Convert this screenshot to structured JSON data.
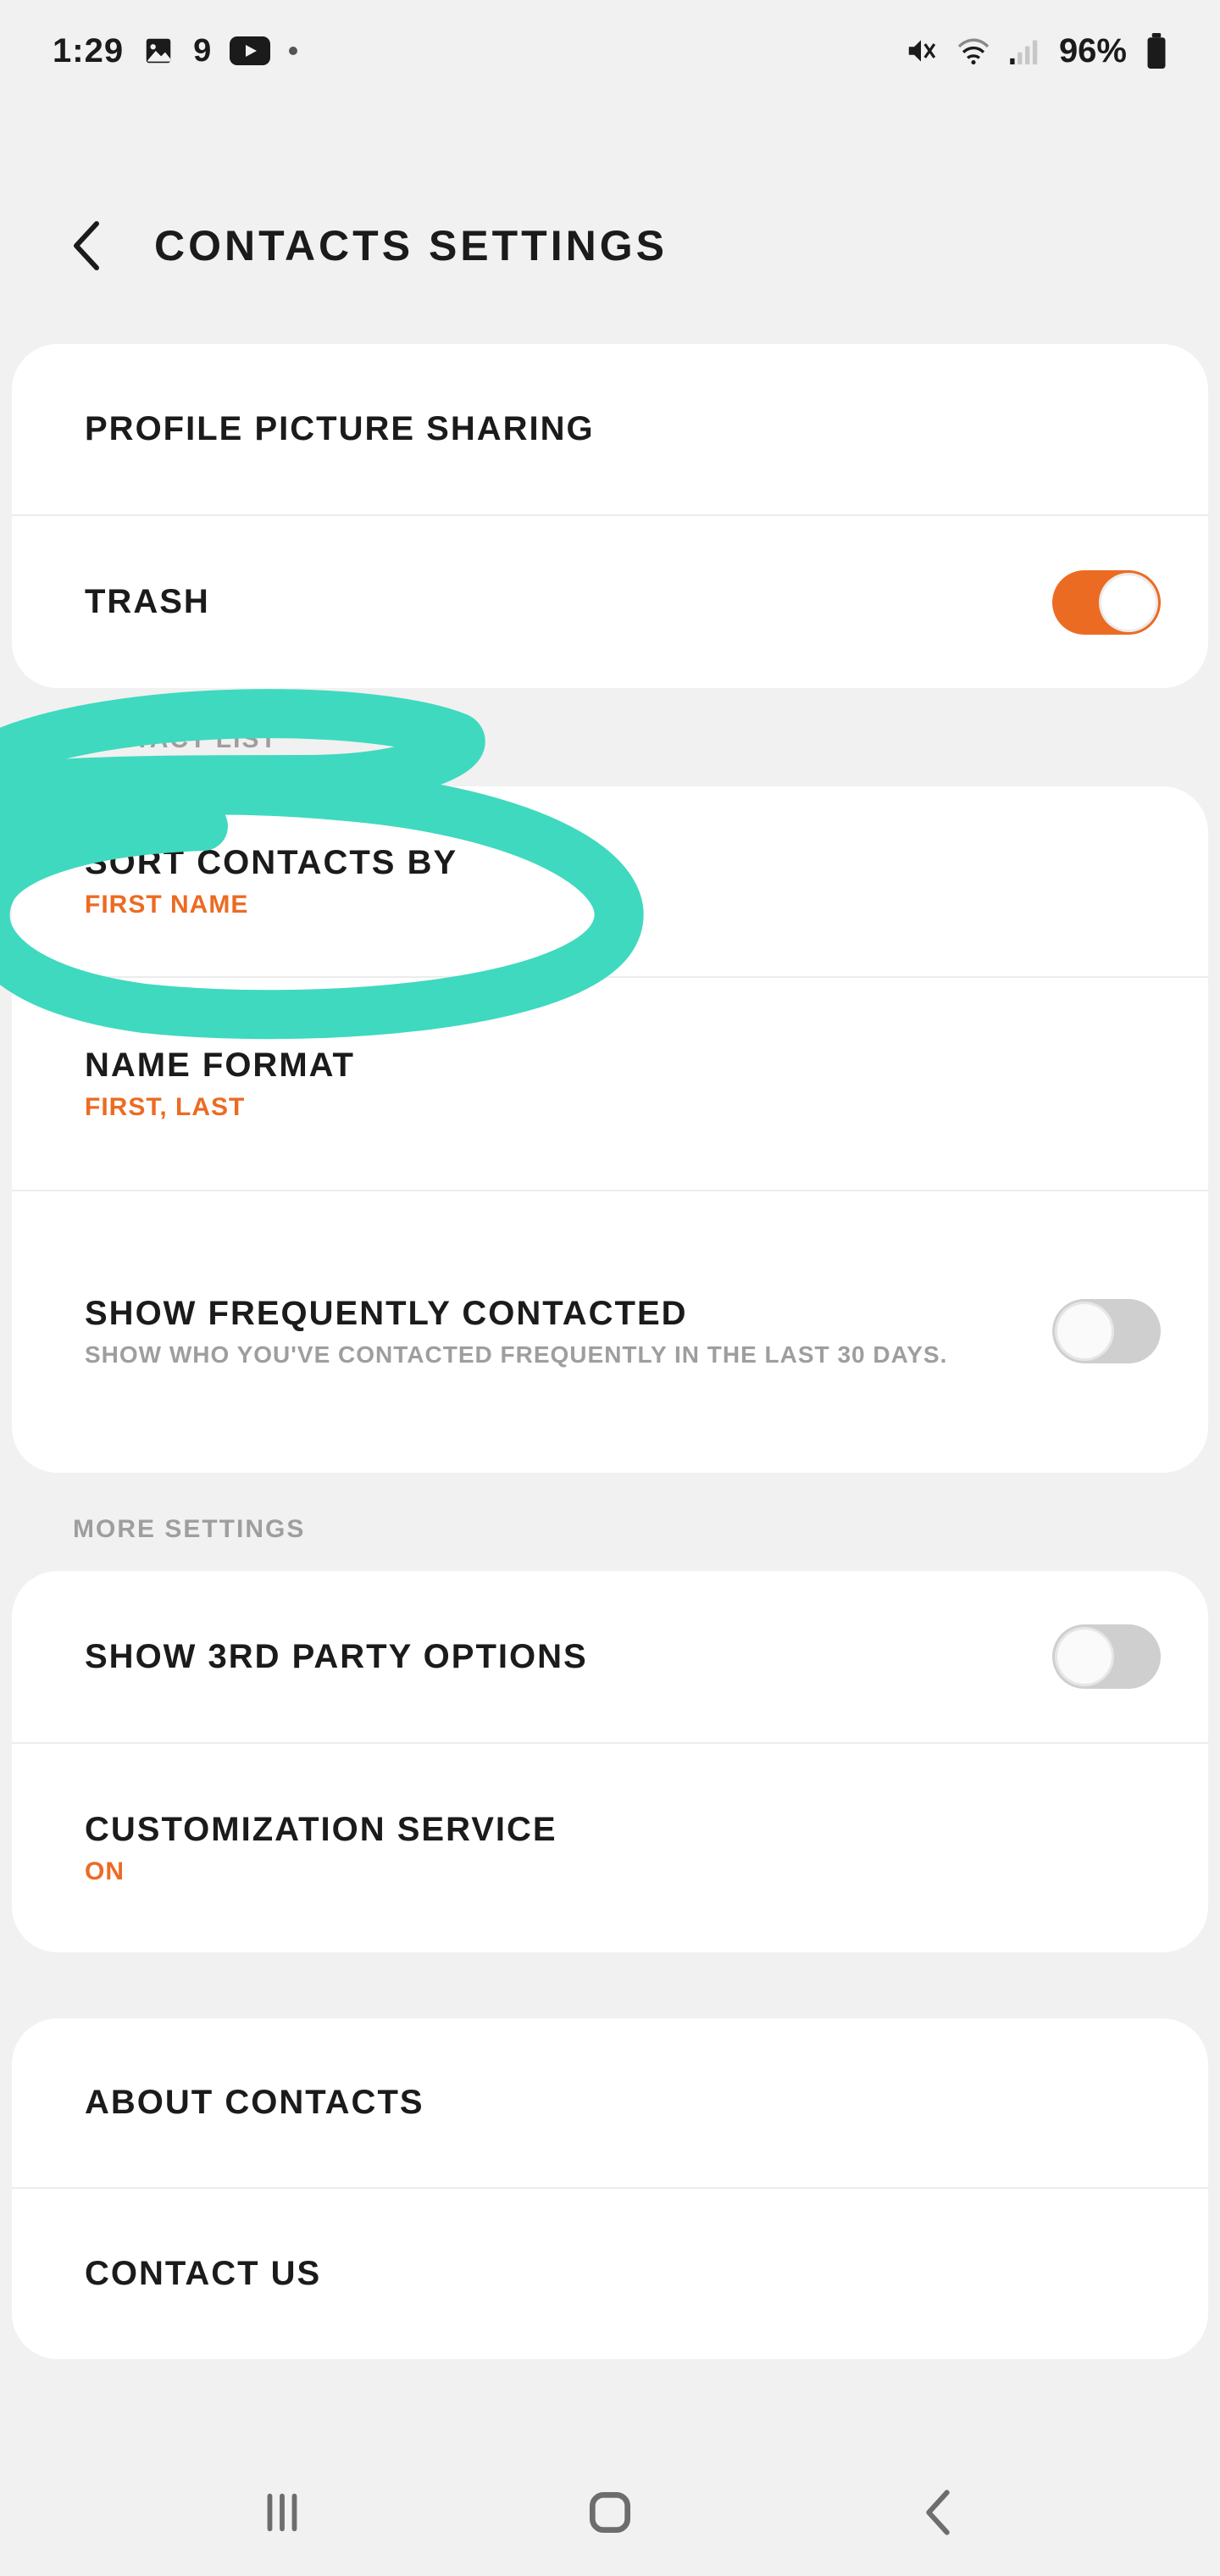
{
  "status": {
    "time": "1:29",
    "notif_count": "9",
    "battery_pct": "96%"
  },
  "header": {
    "title": "CONTACTS SETTINGS"
  },
  "section1": {
    "profile_picture_sharing": "PROFILE PICTURE SHARING",
    "trash": "TRASH",
    "trash_on": true
  },
  "caption1": "CONTACT LIST",
  "section2": {
    "sort_title": "SORT CONTACTS BY",
    "sort_value": "FIRST NAME",
    "name_format_title": "NAME FORMAT",
    "name_format_value": "FIRST, LAST",
    "freq_title": "SHOW FREQUENTLY CONTACTED",
    "freq_desc": "SHOW WHO YOU'VE CONTACTED FREQUENTLY IN THE LAST 30 DAYS.",
    "freq_on": false
  },
  "caption2": "MORE SETTINGS",
  "section3": {
    "third_party_title": "SHOW 3RD PARTY OPTIONS",
    "third_party_on": false,
    "customization_title": "CUSTOMIZATION SERVICE",
    "customization_value": "ON"
  },
  "section4": {
    "about": "ABOUT CONTACTS",
    "contact_us": "CONTACT US"
  },
  "colors": {
    "accent": "#EC6B23",
    "annotation": "#3FD9BF"
  }
}
